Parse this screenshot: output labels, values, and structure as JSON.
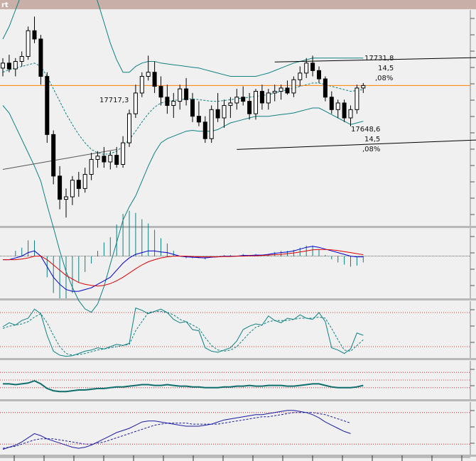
{
  "window": {
    "title_fragment": "rt"
  },
  "colors": {
    "background": "#f0f0f0",
    "panel_border": "#b8b8b8",
    "title_bar": "#c8b0a8",
    "candle": "#000000",
    "bollinger": "#0e8080",
    "bollinger_mid": "#0e8080",
    "price_line": "#ff8000",
    "channel": "#000000",
    "macd_line": "#0000cc",
    "macd_signal": "#dd0000",
    "macd_hist": "#0e8080",
    "stoch_k": "#0e8080",
    "stoch_d": "#0e8080",
    "osc3": "#0e6e6e",
    "osc4": "#1a1aa0",
    "level_lines": "#cc0000"
  },
  "chart_data": [
    {
      "type": "candlestick",
      "panel": "price",
      "annotations": {
        "upper_high": "17731,8",
        "upper_mid": "14,5",
        "upper_pct": ",08%",
        "left_high": "17717,3",
        "lower_value": "17648,6",
        "lower_mid": "14,5",
        "lower_pct": ",08%"
      },
      "ylim": [
        17520,
        17780
      ],
      "current_price": 17689,
      "candles": [
        [
          17710,
          17722,
          17700,
          17716
        ],
        [
          17716,
          17726,
          17705,
          17709
        ],
        [
          17709,
          17722,
          17700,
          17718
        ],
        [
          17718,
          17730,
          17712,
          17724
        ],
        [
          17724,
          17760,
          17720,
          17755
        ],
        [
          17755,
          17772,
          17740,
          17745
        ],
        [
          17745,
          17750,
          17690,
          17700
        ],
        [
          17700,
          17705,
          17620,
          17630
        ],
        [
          17630,
          17635,
          17570,
          17580
        ],
        [
          17580,
          17592,
          17540,
          17552
        ],
        [
          17552,
          17565,
          17530,
          17555
        ],
        [
          17555,
          17580,
          17545,
          17575
        ],
        [
          17575,
          17585,
          17555,
          17565
        ],
        [
          17565,
          17590,
          17560,
          17582
        ],
        [
          17582,
          17608,
          17575,
          17600
        ],
        [
          17600,
          17610,
          17590,
          17604
        ],
        [
          17604,
          17615,
          17590,
          17597
        ],
        [
          17597,
          17610,
          17588,
          17605
        ],
        [
          17605,
          17615,
          17590,
          17594
        ],
        [
          17594,
          17628,
          17590,
          17620
        ],
        [
          17620,
          17660,
          17615,
          17655
        ],
        [
          17655,
          17690,
          17650,
          17680
        ],
        [
          17680,
          17705,
          17675,
          17700
        ],
        [
          17700,
          17725,
          17695,
          17705
        ],
        [
          17705,
          17718,
          17680,
          17688
        ],
        [
          17688,
          17700,
          17665,
          17675
        ],
        [
          17675,
          17690,
          17655,
          17665
        ],
        [
          17665,
          17680,
          17650,
          17670
        ],
        [
          17670,
          17690,
          17660,
          17685
        ],
        [
          17685,
          17698,
          17665,
          17672
        ],
        [
          17672,
          17680,
          17645,
          17652
        ],
        [
          17652,
          17670,
          17640,
          17645
        ],
        [
          17645,
          17652,
          17620,
          17625
        ],
        [
          17625,
          17665,
          17620,
          17660
        ],
        [
          17660,
          17680,
          17645,
          17650
        ],
        [
          17650,
          17672,
          17638,
          17665
        ],
        [
          17665,
          17675,
          17650,
          17668
        ],
        [
          17668,
          17685,
          17660,
          17675
        ],
        [
          17675,
          17688,
          17665,
          17670
        ],
        [
          17670,
          17680,
          17648,
          17655
        ],
        [
          17655,
          17685,
          17648,
          17682
        ],
        [
          17682,
          17690,
          17660,
          17668
        ],
        [
          17668,
          17685,
          17660,
          17680
        ],
        [
          17680,
          17690,
          17670,
          17682
        ],
        [
          17682,
          17690,
          17672,
          17686
        ],
        [
          17686,
          17695,
          17678,
          17680
        ],
        [
          17680,
          17700,
          17675,
          17696
        ],
        [
          17696,
          17712,
          17688,
          17704
        ],
        [
          17704,
          17722,
          17698,
          17716
        ],
        [
          17716,
          17725,
          17700,
          17707
        ],
        [
          17707,
          17712,
          17692,
          17697
        ],
        [
          17697,
          17700,
          17670,
          17675
        ],
        [
          17675,
          17682,
          17655,
          17660
        ],
        [
          17660,
          17672,
          17650,
          17668
        ],
        [
          17668,
          17672,
          17645,
          17650
        ],
        [
          17650,
          17665,
          17640,
          17660
        ],
        [
          17660,
          17690,
          17655,
          17686
        ],
        [
          17686,
          17692,
          17680,
          17689
        ]
      ],
      "boll_upper": [
        17745,
        17760,
        17780,
        17800,
        17820,
        17840,
        17850,
        17855,
        17852,
        17850,
        17845,
        17838,
        17830,
        17820,
        17808,
        17790,
        17765,
        17740,
        17720,
        17705,
        17705,
        17712,
        17716,
        17718,
        17718,
        17716,
        17715,
        17714,
        17713,
        17712,
        17711,
        17710,
        17708,
        17706,
        17704,
        17702,
        17700,
        17700,
        17700,
        17700,
        17700,
        17702,
        17704,
        17707,
        17710,
        17713,
        17716,
        17718,
        17720,
        17722,
        17722,
        17722,
        17722,
        17722,
        17722,
        17722,
        17722,
        17722
      ],
      "boll_mid": [
        17705,
        17708,
        17710,
        17712,
        17714,
        17716,
        17712,
        17700,
        17685,
        17670,
        17655,
        17642,
        17630,
        17620,
        17612,
        17608,
        17606,
        17607,
        17610,
        17616,
        17624,
        17634,
        17645,
        17655,
        17663,
        17668,
        17670,
        17671,
        17672,
        17673,
        17673,
        17672,
        17671,
        17670,
        17670,
        17671,
        17672,
        17673,
        17674,
        17675,
        17676,
        17677,
        17678,
        17680,
        17682,
        17684,
        17686,
        17688,
        17690,
        17692,
        17692,
        17690,
        17688,
        17686,
        17684,
        17682,
        17683,
        17684
      ],
      "boll_lower": [
        17665,
        17656,
        17640,
        17624,
        17608,
        17592,
        17574,
        17545,
        17518,
        17490,
        17465,
        17446,
        17430,
        17420,
        17416,
        17426,
        17447,
        17474,
        17500,
        17527,
        17543,
        17556,
        17574,
        17592,
        17608,
        17620,
        17625,
        17628,
        17631,
        17634,
        17635,
        17634,
        17634,
        17634,
        17636,
        17640,
        17644,
        17646,
        17648,
        17650,
        17652,
        17652,
        17652,
        17653,
        17654,
        17655,
        17656,
        17658,
        17660,
        17662,
        17662,
        17658,
        17654,
        17650,
        17646,
        17642,
        17644,
        17646
      ],
      "channel_upper": {
        "from": [
          43,
          17717.3
        ],
        "to": [
          130,
          17731.8
        ]
      },
      "channel_lower": {
        "from": [
          37,
          17612
        ],
        "to": [
          130,
          17640
        ]
      },
      "trend_line": {
        "from": [
          0,
          17588
        ],
        "to": [
          18,
          17612
        ]
      }
    },
    {
      "type": "line",
      "panel": "macd",
      "ylim": [
        -12,
        8
      ],
      "macd": [
        -1,
        -1,
        -0.5,
        0,
        1,
        1.5,
        0,
        -3,
        -6,
        -8,
        -9.5,
        -10,
        -10,
        -9.5,
        -9,
        -8,
        -7,
        -6,
        -4,
        -2,
        -0.5,
        0.5,
        1,
        1.5,
        1.5,
        1.2,
        1,
        0.5,
        0,
        -0.2,
        -0.3,
        -0.4,
        -0.5,
        -0.3,
        -0.2,
        0,
        0,
        0,
        0.2,
        0.2,
        0.3,
        0.3,
        0.5,
        0.8,
        1,
        1.2,
        1.5,
        2,
        2.5,
        2.8,
        2.5,
        2,
        1.5,
        1,
        0.5,
        0,
        -0.2,
        -0.2
      ],
      "signal": [
        -1,
        -1,
        -1,
        -0.8,
        -0.5,
        0,
        0,
        -1,
        -2.5,
        -4,
        -5.5,
        -6.5,
        -7.5,
        -8,
        -8.3,
        -8.5,
        -8.3,
        -7.8,
        -7,
        -6,
        -4.8,
        -3.6,
        -2.5,
        -1.6,
        -1,
        -0.5,
        -0.2,
        0,
        0,
        0,
        -0.1,
        -0.2,
        -0.2,
        -0.2,
        -0.2,
        -0.1,
        -0.1,
        0,
        0,
        0.1,
        0.1,
        0.2,
        0.3,
        0.4,
        0.5,
        0.7,
        0.9,
        1.2,
        1.5,
        1.8,
        1.9,
        1.9,
        1.8,
        1.6,
        1.3,
        1,
        0.7,
        0.4
      ]
    },
    {
      "type": "line",
      "panel": "stochastic",
      "ylim": [
        0,
        100
      ],
      "levels": [
        80,
        20
      ],
      "k": [
        55,
        62,
        58,
        66,
        70,
        86,
        78,
        40,
        12,
        5,
        3,
        4,
        8,
        12,
        14,
        18,
        16,
        20,
        24,
        22,
        26,
        88,
        84,
        78,
        82,
        86,
        80,
        68,
        62,
        64,
        50,
        48,
        18,
        12,
        10,
        14,
        18,
        30,
        50,
        56,
        60,
        58,
        74,
        66,
        62,
        70,
        68,
        76,
        70,
        68,
        80,
        64,
        18,
        14,
        8,
        16,
        44,
        40
      ],
      "d": [
        52,
        56,
        58,
        60,
        64,
        72,
        78,
        62,
        40,
        20,
        8,
        5,
        6,
        8,
        11,
        14,
        16,
        18,
        20,
        22,
        24,
        48,
        64,
        80,
        82,
        82,
        80,
        76,
        68,
        64,
        58,
        52,
        36,
        22,
        14,
        12,
        14,
        20,
        32,
        44,
        54,
        58,
        64,
        66,
        66,
        66,
        68,
        70,
        70,
        70,
        72,
        70,
        52,
        32,
        14,
        12,
        22,
        32
      ]
    },
    {
      "type": "line",
      "panel": "osc3",
      "ylim": [
        0,
        100
      ],
      "levels": [
        70,
        50,
        30
      ],
      "values": [
        40,
        40,
        38,
        40,
        42,
        48,
        40,
        28,
        22,
        20,
        20,
        22,
        24,
        24,
        26,
        28,
        28,
        30,
        32,
        32,
        34,
        36,
        38,
        38,
        36,
        36,
        38,
        36,
        34,
        34,
        32,
        32,
        30,
        30,
        30,
        32,
        32,
        34,
        34,
        36,
        34,
        34,
        36,
        36,
        36,
        34,
        34,
        36,
        38,
        40,
        40,
        36,
        32,
        30,
        30,
        30,
        32,
        36
      ]
    },
    {
      "type": "line",
      "panel": "osc4",
      "ylim": [
        0,
        100
      ],
      "levels": [
        80,
        20
      ],
      "a": [
        10,
        14,
        18,
        24,
        32,
        40,
        36,
        30,
        26,
        22,
        18,
        14,
        12,
        14,
        18,
        24,
        30,
        36,
        42,
        46,
        50,
        56,
        62,
        64,
        64,
        62,
        60,
        58,
        56,
        54,
        54,
        54,
        56,
        58,
        62,
        66,
        68,
        70,
        72,
        74,
        76,
        76,
        78,
        80,
        82,
        84,
        84,
        82,
        80,
        76,
        70,
        62,
        56,
        50,
        44,
        40
      ],
      "b": [
        12,
        14,
        16,
        20,
        24,
        28,
        30,
        30,
        30,
        28,
        26,
        24,
        22,
        20,
        20,
        22,
        24,
        28,
        32,
        36,
        40,
        44,
        48,
        52,
        56,
        58,
        60,
        60,
        60,
        60,
        58,
        58,
        58,
        58,
        58,
        60,
        62,
        64,
        66,
        68,
        70,
        72,
        72,
        74,
        76,
        78,
        80,
        80,
        80,
        80,
        78,
        76,
        72,
        68,
        64,
        60
      ]
    }
  ]
}
